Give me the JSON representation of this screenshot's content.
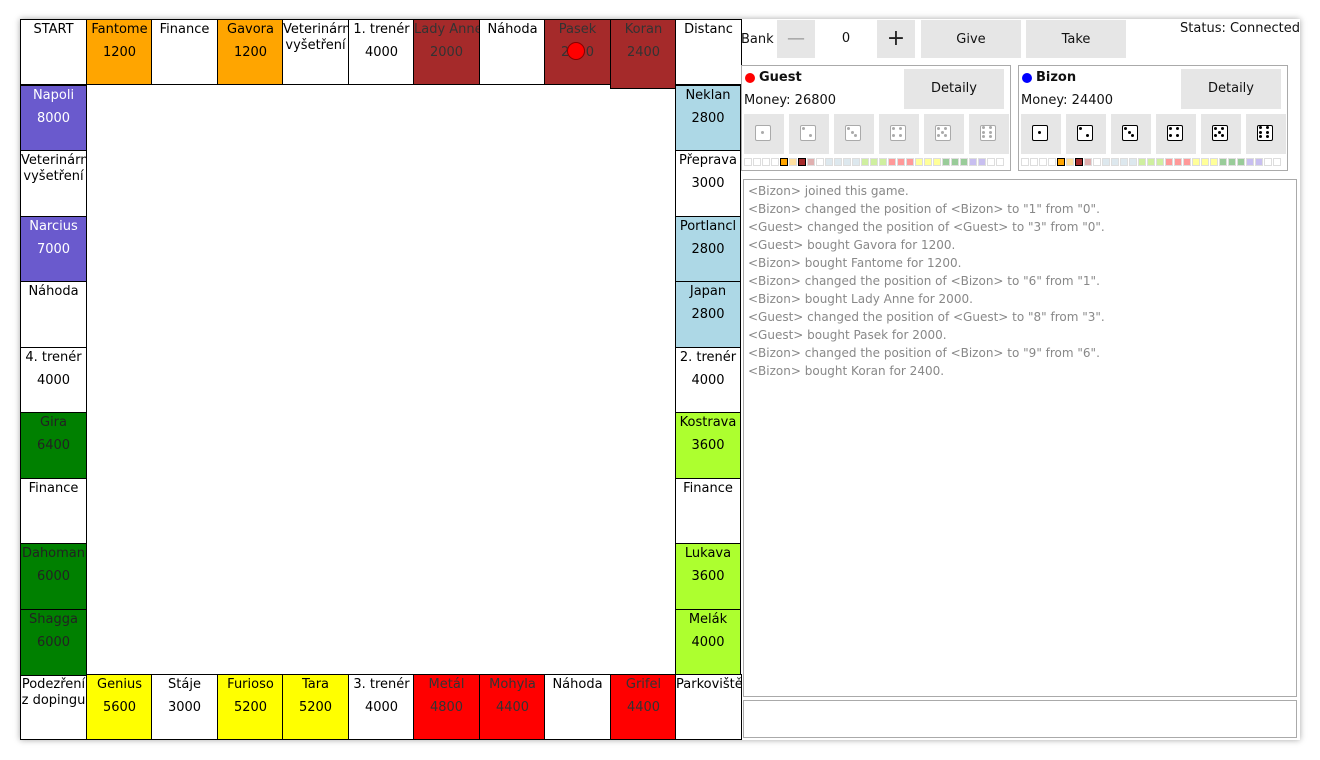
{
  "board": {
    "top": [
      {
        "name": "START",
        "price": "",
        "color": "#ffffff",
        "text": "#000"
      },
      {
        "name": "Fantome",
        "price": "1200",
        "color": "#ffa500",
        "text": "#000"
      },
      {
        "name": "Finance",
        "price": "",
        "color": "#ffffff",
        "text": "#000"
      },
      {
        "name": "Gavora",
        "price": "1200",
        "color": "#ffa500",
        "text": "#000"
      },
      {
        "name": "Veterinární vyšetření",
        "price": "",
        "color": "#ffffff",
        "text": "#000",
        "wrap": true
      },
      {
        "name": "1. trenér",
        "price": "4000",
        "color": "#ffffff",
        "text": "#000"
      },
      {
        "name": "Lady Anne",
        "price": "2000",
        "color": "#a52a2a",
        "text": "#333"
      },
      {
        "name": "Náhoda",
        "price": "",
        "color": "#ffffff",
        "text": "#000"
      },
      {
        "name": "Pasek",
        "price": "2000",
        "color": "#a52a2a",
        "text": "#333"
      },
      {
        "name": "Koran",
        "price": "2400",
        "color": "#a52a2a",
        "text": "#333"
      },
      {
        "name": "Distanc",
        "price": "",
        "color": "#ffffff",
        "text": "#000"
      }
    ],
    "right": [
      {
        "name": "Neklan",
        "price": "2800",
        "color": "#add8e6",
        "text": "#000"
      },
      {
        "name": "Přeprava",
        "price": "3000",
        "color": "#ffffff",
        "text": "#000"
      },
      {
        "name": "Portlancl",
        "price": "2800",
        "color": "#add8e6",
        "text": "#000"
      },
      {
        "name": "Japan",
        "price": "2800",
        "color": "#add8e6",
        "text": "#000"
      },
      {
        "name": "2. trenér",
        "price": "4000",
        "color": "#ffffff",
        "text": "#000"
      },
      {
        "name": "Kostrava",
        "price": "3600",
        "color": "#adff2f",
        "text": "#000"
      },
      {
        "name": "Finance",
        "price": "",
        "color": "#ffffff",
        "text": "#000"
      },
      {
        "name": "Lukava",
        "price": "3600",
        "color": "#adff2f",
        "text": "#000"
      },
      {
        "name": "Melák",
        "price": "4000",
        "color": "#adff2f",
        "text": "#000"
      }
    ],
    "bottom": [
      {
        "name": "Podezření z dopingu",
        "price": "",
        "color": "#ffffff",
        "text": "#000",
        "wrap": true
      },
      {
        "name": "Genius",
        "price": "5600",
        "color": "#ffff00",
        "text": "#000"
      },
      {
        "name": "Stáje",
        "price": "3000",
        "color": "#ffffff",
        "text": "#000"
      },
      {
        "name": "Furioso",
        "price": "5200",
        "color": "#ffff00",
        "text": "#000"
      },
      {
        "name": "Tara",
        "price": "5200",
        "color": "#ffff00",
        "text": "#000"
      },
      {
        "name": "3. trenér",
        "price": "4000",
        "color": "#ffffff",
        "text": "#000"
      },
      {
        "name": "Metál",
        "price": "4800",
        "color": "#ff0000",
        "text": "#333"
      },
      {
        "name": "Mohyla",
        "price": "4400",
        "color": "#ff0000",
        "text": "#333"
      },
      {
        "name": "Náhoda",
        "price": "",
        "color": "#ffffff",
        "text": "#000"
      },
      {
        "name": "Grifel",
        "price": "4400",
        "color": "#ff0000",
        "text": "#333"
      },
      {
        "name": "Parkoviště",
        "price": "",
        "color": "#ffffff",
        "text": "#000"
      }
    ],
    "left": [
      {
        "name": "Napoli",
        "price": "8000",
        "color": "#6a5acd",
        "text": "#fff"
      },
      {
        "name": "Veterinární vyšetření",
        "price": "",
        "color": "#ffffff",
        "text": "#000",
        "wrap": true
      },
      {
        "name": "Narcius",
        "price": "7000",
        "color": "#6a5acd",
        "text": "#fff"
      },
      {
        "name": "Náhoda",
        "price": "",
        "color": "#ffffff",
        "text": "#000"
      },
      {
        "name": "4. trenér",
        "price": "4000",
        "color": "#ffffff",
        "text": "#000"
      },
      {
        "name": "Gira",
        "price": "6400",
        "color": "#008000",
        "text": "#222"
      },
      {
        "name": "Finance",
        "price": "",
        "color": "#ffffff",
        "text": "#000"
      },
      {
        "name": "Dahoman",
        "price": "6000",
        "color": "#008000",
        "text": "#222"
      },
      {
        "name": "Shagga",
        "price": "6000",
        "color": "#008000",
        "text": "#222"
      }
    ]
  },
  "bank": {
    "label": "Bank",
    "minus": "—",
    "value": "0",
    "plus": "+",
    "give": "Give",
    "take": "Take"
  },
  "status": "Status: Connected",
  "players": [
    {
      "name": "Guest",
      "money": "Money: 26800",
      "detail": "Detaily",
      "color": "#ff0000",
      "dice_active": false
    },
    {
      "name": "Bizon",
      "money": "Money: 24400",
      "detail": "Detaily",
      "color": "#0000ff",
      "dice_active": true
    }
  ],
  "property_strip": [
    "#ffffff",
    "#ffffff",
    "#ffffff",
    "#ffffff",
    "#ffa500",
    "#ffe0a0",
    "#a52a2a",
    "#e0b0b0",
    "#ffffff",
    "#dde8ee",
    "#dde8ee",
    "#dde8ee",
    "#dde8ee",
    "#cfefa0",
    "#cfefa0",
    "#cfefa0",
    "#ff9999",
    "#ff9999",
    "#ff9999",
    "#ffff99",
    "#ffff99",
    "#ffff99",
    "#99cc99",
    "#99cc99",
    "#99cc99",
    "#c8bff0",
    "#c8bff0",
    "#ffffff",
    "#ffffff"
  ],
  "log": [
    "<Bizon> joined this game.",
    "<Bizon> changed the position of <Bizon> to \"1\" from \"0\".",
    "<Guest> changed the position of <Guest> to \"3\" from \"0\".",
    "<Guest> bought Gavora for 1200.",
    "<Bizon> bought Fantome for 1200.",
    "<Bizon> changed the position of <Bizon> to \"6\" from \"1\".",
    "<Bizon> bought Lady Anne for 2000.",
    "<Guest> changed the position of <Guest> to \"8\" from \"3\".",
    "<Guest> bought Pasek for 2000.",
    "<Bizon> changed the position of <Bizon> to \"9\" from \"6\".",
    "<Bizon> bought Koran for 2400."
  ]
}
